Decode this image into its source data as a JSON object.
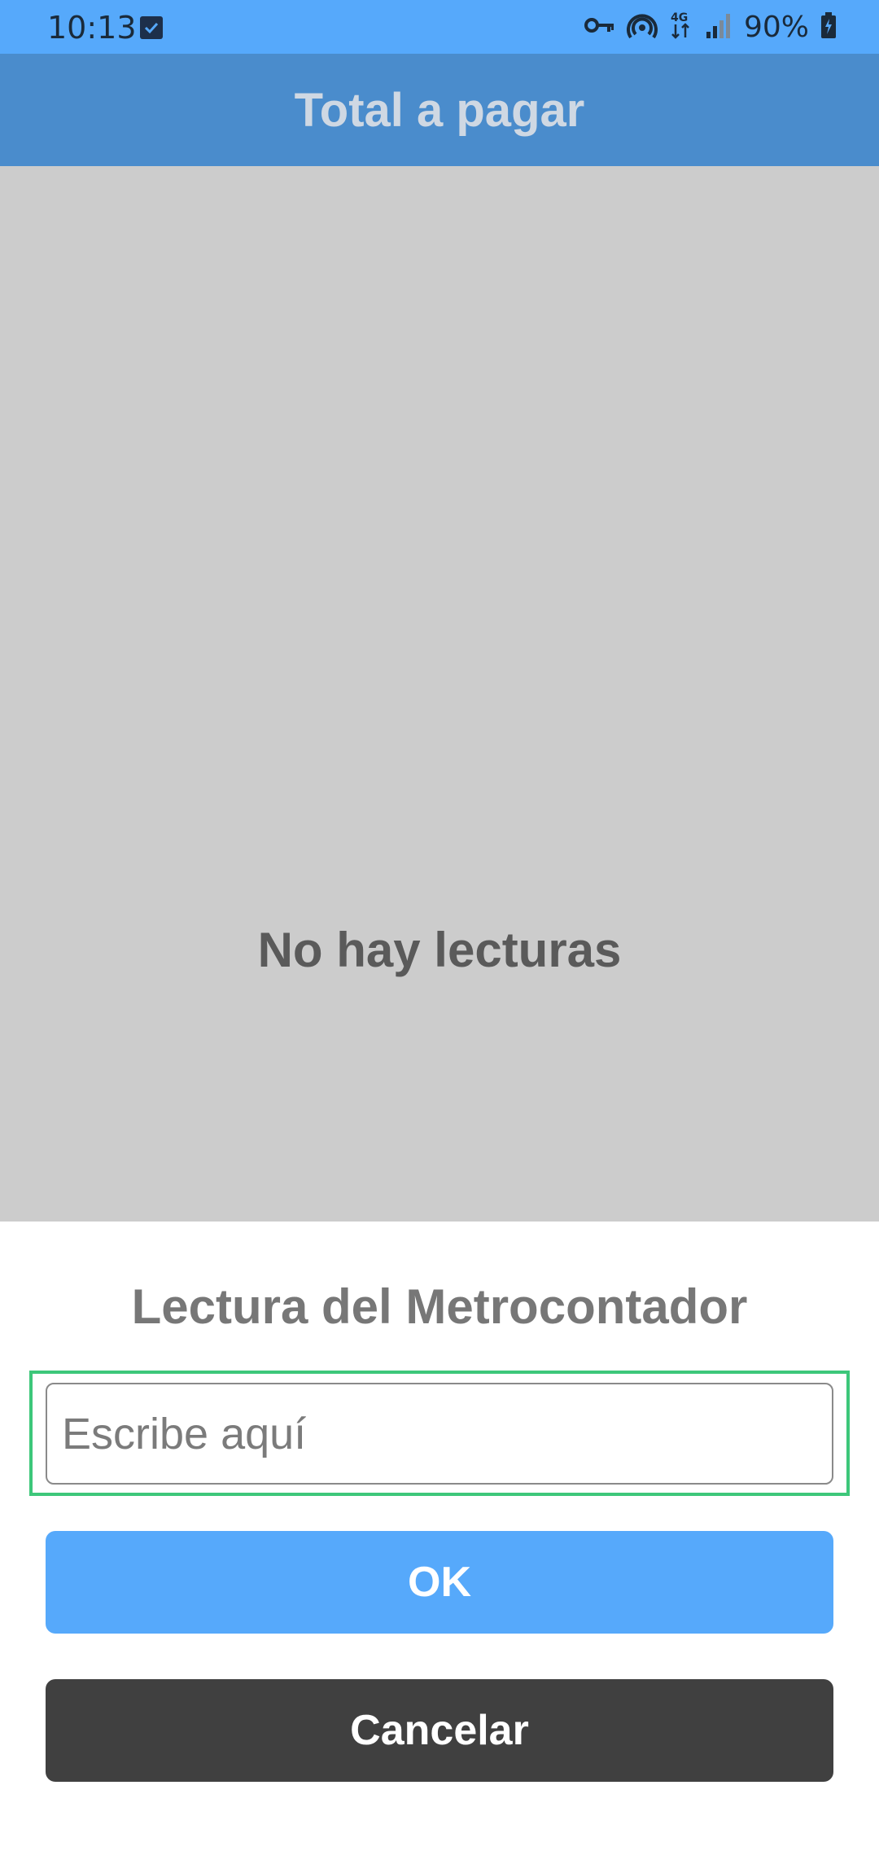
{
  "status_bar": {
    "time": "10:13",
    "battery_percent": "90%",
    "network": "4G",
    "icons": [
      "checkbox-notification-icon",
      "vpn-key-icon",
      "hotspot-icon",
      "network-4g-icon",
      "signal-icon",
      "battery-charging-icon"
    ]
  },
  "app_bar": {
    "title": "Total a pagar"
  },
  "main": {
    "empty_message": "No hay lecturas"
  },
  "dialog": {
    "title": "Lectura del Metrocontador",
    "input_placeholder": "Escribe aquí",
    "input_value": "",
    "ok_label": "OK",
    "cancel_label": "Cancelar"
  },
  "colors": {
    "status_bar": "#56a9fb",
    "app_bar": "#4a8ccc",
    "ok_button": "#56a9fb",
    "cancel_button": "#404040",
    "focus_outline": "#3dc77a"
  }
}
